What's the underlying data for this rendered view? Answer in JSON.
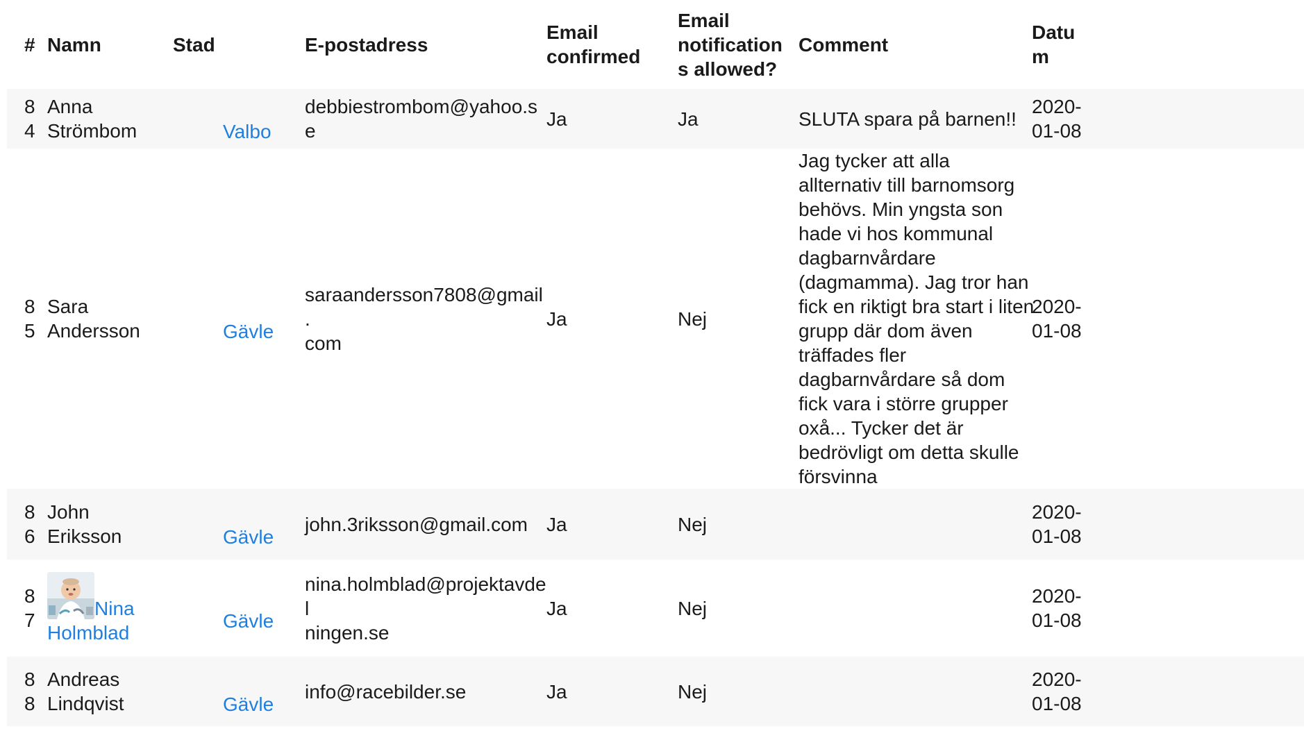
{
  "table": {
    "headers": {
      "num": "#",
      "name": "Namn",
      "city": "Stad",
      "email": "E-postadress",
      "email_confirmed_1": "Email",
      "email_confirmed_2": "confirmed",
      "notif_1": "Email",
      "notif_2": "notification",
      "notif_3": "s allowed?",
      "comment": "Comment",
      "date_1": "Datu",
      "date_2": "m"
    },
    "rows": [
      {
        "num_1": "8",
        "num_2": "4",
        "name_1": "Anna",
        "name_2": "Strömbom",
        "city": "Valbo",
        "email": "debbiestrombom@yahoo.se",
        "confirmed": "Ja",
        "notifications": "Ja",
        "comment": "SLUTA spara på barnen!!",
        "date_1": "2020-",
        "date_2": "01-08"
      },
      {
        "num_1": "8",
        "num_2": "5",
        "name_1": "Sara",
        "name_2": "Andersson",
        "city": "Gävle",
        "email_1": "saraandersson7808@gmail.",
        "email_2": "com",
        "confirmed": "Ja",
        "notifications": "Nej",
        "comment": "Jag tycker att alla allternativ till barnomsorg behövs. Min yngsta son hade vi hos kommunal dagbarnvårdare (dagmamma). Jag tror han fick en riktigt bra start i liten grupp där dom även träffades fler dagbarnvårdare så dom fick vara i större grupper oxå... Tycker det är bedrövligt om detta skulle försvinna",
        "date_1": "2020-",
        "date_2": "01-08"
      },
      {
        "num_1": "8",
        "num_2": "6",
        "name_1": "John",
        "name_2": "Eriksson",
        "city": "Gävle",
        "email": "john.3riksson@gmail.com",
        "confirmed": "Ja",
        "notifications": "Nej",
        "comment": "",
        "date_1": "2020-",
        "date_2": "01-08"
      },
      {
        "num_1": "8",
        "num_2": "7",
        "name_1": "Nina",
        "name_2": "Holmblad",
        "city": "Gävle",
        "email_1": "nina.holmblad@projektavdel",
        "email_2": "ningen.se",
        "confirmed": "Ja",
        "notifications": "Nej",
        "comment": "",
        "date_1": "2020-",
        "date_2": "01-08"
      },
      {
        "num_1": "8",
        "num_2": "8",
        "name_1": "Andreas",
        "name_2": "Lindqvist",
        "city": "Gävle",
        "email": "info@racebilder.se",
        "confirmed": "Ja",
        "notifications": "Nej",
        "comment": "",
        "date_1": "2020-",
        "date_2": "01-08"
      }
    ]
  },
  "colors": {
    "link": "#1f7fe0",
    "row_stripe": "#f7f7f7",
    "text": "#1a1a1a"
  }
}
